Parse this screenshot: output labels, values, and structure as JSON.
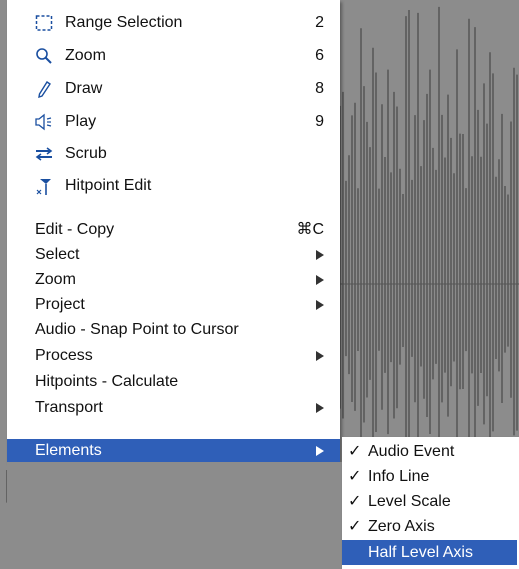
{
  "menu": {
    "tool_items": [
      {
        "icon": "range-selection-icon",
        "label": "Range Selection",
        "shortcut": "2"
      },
      {
        "icon": "zoom-icon",
        "label": "Zoom",
        "shortcut": "6"
      },
      {
        "icon": "draw-icon",
        "label": "Draw",
        "shortcut": "8"
      },
      {
        "icon": "play-icon",
        "label": "Play",
        "shortcut": "9"
      },
      {
        "icon": "scrub-icon",
        "label": "Scrub",
        "shortcut": ""
      },
      {
        "icon": "hitpoint-edit-icon",
        "label": "Hitpoint Edit",
        "shortcut": ""
      }
    ],
    "command_items": [
      {
        "label": "Edit - Copy",
        "shortcut": "⌘C",
        "submenu": false
      },
      {
        "label": "Select",
        "shortcut": "",
        "submenu": true
      },
      {
        "label": "Zoom",
        "shortcut": "",
        "submenu": true
      },
      {
        "label": "Project",
        "shortcut": "",
        "submenu": true
      },
      {
        "label": "Audio - Snap Point to Cursor",
        "shortcut": "",
        "submenu": false
      },
      {
        "label": "Process",
        "shortcut": "",
        "submenu": true
      },
      {
        "label": "Hitpoints - Calculate",
        "shortcut": "",
        "submenu": false
      },
      {
        "label": "Transport",
        "shortcut": "",
        "submenu": true
      },
      {
        "label": "Elements",
        "shortcut": "",
        "submenu": true,
        "highlighted": true
      }
    ]
  },
  "elements_submenu": {
    "items": [
      {
        "label": "Audio Event",
        "checked": true,
        "check_mark": "✓"
      },
      {
        "label": "Info Line",
        "checked": true,
        "check_mark": "✓"
      },
      {
        "label": "Level Scale",
        "checked": true,
        "check_mark": "✓"
      },
      {
        "label": "Zero Axis",
        "checked": true,
        "check_mark": "✓"
      },
      {
        "label": "Half Level Axis",
        "checked": false,
        "check_mark": "",
        "highlighted": true
      }
    ]
  },
  "colors": {
    "highlight": "#2f5fb8",
    "menu_bg": "#ffffff",
    "waveform_bg": "#8c8c8c",
    "waveform": "#3a3a3a"
  }
}
